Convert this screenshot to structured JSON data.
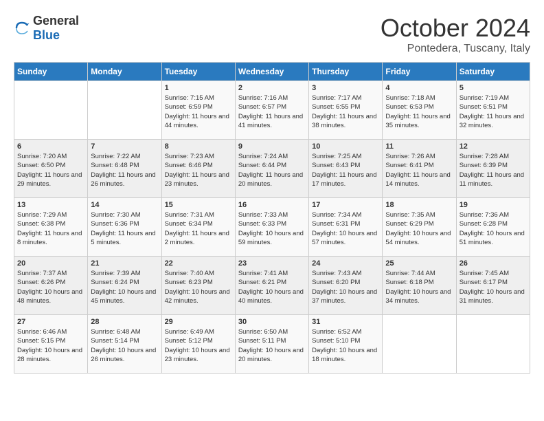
{
  "logo": {
    "general": "General",
    "blue": "Blue"
  },
  "title": "October 2024",
  "location": "Pontedera, Tuscany, Italy",
  "days_of_week": [
    "Sunday",
    "Monday",
    "Tuesday",
    "Wednesday",
    "Thursday",
    "Friday",
    "Saturday"
  ],
  "weeks": [
    [
      {
        "day": "",
        "info": ""
      },
      {
        "day": "",
        "info": ""
      },
      {
        "day": "1",
        "sunrise": "7:15 AM",
        "sunset": "6:59 PM",
        "daylight": "11 hours and 44 minutes."
      },
      {
        "day": "2",
        "sunrise": "7:16 AM",
        "sunset": "6:57 PM",
        "daylight": "11 hours and 41 minutes."
      },
      {
        "day": "3",
        "sunrise": "7:17 AM",
        "sunset": "6:55 PM",
        "daylight": "11 hours and 38 minutes."
      },
      {
        "day": "4",
        "sunrise": "7:18 AM",
        "sunset": "6:53 PM",
        "daylight": "11 hours and 35 minutes."
      },
      {
        "day": "5",
        "sunrise": "7:19 AM",
        "sunset": "6:51 PM",
        "daylight": "11 hours and 32 minutes."
      }
    ],
    [
      {
        "day": "6",
        "sunrise": "7:20 AM",
        "sunset": "6:50 PM",
        "daylight": "11 hours and 29 minutes."
      },
      {
        "day": "7",
        "sunrise": "7:22 AM",
        "sunset": "6:48 PM",
        "daylight": "11 hours and 26 minutes."
      },
      {
        "day": "8",
        "sunrise": "7:23 AM",
        "sunset": "6:46 PM",
        "daylight": "11 hours and 23 minutes."
      },
      {
        "day": "9",
        "sunrise": "7:24 AM",
        "sunset": "6:44 PM",
        "daylight": "11 hours and 20 minutes."
      },
      {
        "day": "10",
        "sunrise": "7:25 AM",
        "sunset": "6:43 PM",
        "daylight": "11 hours and 17 minutes."
      },
      {
        "day": "11",
        "sunrise": "7:26 AM",
        "sunset": "6:41 PM",
        "daylight": "11 hours and 14 minutes."
      },
      {
        "day": "12",
        "sunrise": "7:28 AM",
        "sunset": "6:39 PM",
        "daylight": "11 hours and 11 minutes."
      }
    ],
    [
      {
        "day": "13",
        "sunrise": "7:29 AM",
        "sunset": "6:38 PM",
        "daylight": "11 hours and 8 minutes."
      },
      {
        "day": "14",
        "sunrise": "7:30 AM",
        "sunset": "6:36 PM",
        "daylight": "11 hours and 5 minutes."
      },
      {
        "day": "15",
        "sunrise": "7:31 AM",
        "sunset": "6:34 PM",
        "daylight": "11 hours and 2 minutes."
      },
      {
        "day": "16",
        "sunrise": "7:33 AM",
        "sunset": "6:33 PM",
        "daylight": "10 hours and 59 minutes."
      },
      {
        "day": "17",
        "sunrise": "7:34 AM",
        "sunset": "6:31 PM",
        "daylight": "10 hours and 57 minutes."
      },
      {
        "day": "18",
        "sunrise": "7:35 AM",
        "sunset": "6:29 PM",
        "daylight": "10 hours and 54 minutes."
      },
      {
        "day": "19",
        "sunrise": "7:36 AM",
        "sunset": "6:28 PM",
        "daylight": "10 hours and 51 minutes."
      }
    ],
    [
      {
        "day": "20",
        "sunrise": "7:37 AM",
        "sunset": "6:26 PM",
        "daylight": "10 hours and 48 minutes."
      },
      {
        "day": "21",
        "sunrise": "7:39 AM",
        "sunset": "6:24 PM",
        "daylight": "10 hours and 45 minutes."
      },
      {
        "day": "22",
        "sunrise": "7:40 AM",
        "sunset": "6:23 PM",
        "daylight": "10 hours and 42 minutes."
      },
      {
        "day": "23",
        "sunrise": "7:41 AM",
        "sunset": "6:21 PM",
        "daylight": "10 hours and 40 minutes."
      },
      {
        "day": "24",
        "sunrise": "7:43 AM",
        "sunset": "6:20 PM",
        "daylight": "10 hours and 37 minutes."
      },
      {
        "day": "25",
        "sunrise": "7:44 AM",
        "sunset": "6:18 PM",
        "daylight": "10 hours and 34 minutes."
      },
      {
        "day": "26",
        "sunrise": "7:45 AM",
        "sunset": "6:17 PM",
        "daylight": "10 hours and 31 minutes."
      }
    ],
    [
      {
        "day": "27",
        "sunrise": "6:46 AM",
        "sunset": "5:15 PM",
        "daylight": "10 hours and 28 minutes."
      },
      {
        "day": "28",
        "sunrise": "6:48 AM",
        "sunset": "5:14 PM",
        "daylight": "10 hours and 26 minutes."
      },
      {
        "day": "29",
        "sunrise": "6:49 AM",
        "sunset": "5:12 PM",
        "daylight": "10 hours and 23 minutes."
      },
      {
        "day": "30",
        "sunrise": "6:50 AM",
        "sunset": "5:11 PM",
        "daylight": "10 hours and 20 minutes."
      },
      {
        "day": "31",
        "sunrise": "6:52 AM",
        "sunset": "5:10 PM",
        "daylight": "10 hours and 18 minutes."
      },
      {
        "day": "",
        "info": ""
      },
      {
        "day": "",
        "info": ""
      }
    ]
  ]
}
